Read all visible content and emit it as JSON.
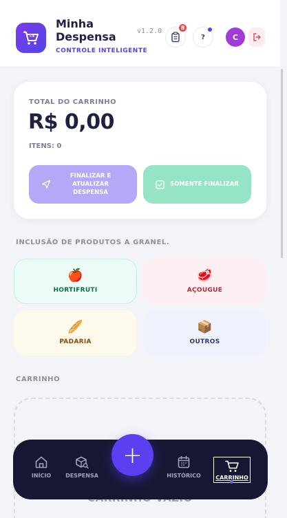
{
  "header": {
    "title": "Minha Despensa",
    "subtitle": "CONTROLE INTELIGENTE",
    "version": "v1.2.0",
    "list_badge": "8",
    "help_label": "?",
    "avatar_initial": "C"
  },
  "summary": {
    "label": "TOTAL DO CARRINHO",
    "total": "R$ 0,00",
    "items": "ITENS: 0",
    "finalize_update_label": "FINALIZAR E ATUALIZAR DESPENSA",
    "finalize_only_label": "SOMENTE FINALIZAR"
  },
  "bulk": {
    "title": "INCLUSÃO DE PRODUTOS A GRANEL.",
    "categories": [
      {
        "label": "HORTIFRUTI",
        "icon": "🍎"
      },
      {
        "label": "AÇOUGUE",
        "icon": "🥩"
      },
      {
        "label": "PADARIA",
        "icon": "🥖"
      },
      {
        "label": "OUTROS",
        "icon": "📦"
      }
    ]
  },
  "cart": {
    "title": "CARRINHO",
    "empty_label": "CARRINHO VAZIO"
  },
  "nav": {
    "items": [
      {
        "label": "INÍCIO",
        "icon": "home-icon"
      },
      {
        "label": "DESPENSA",
        "icon": "box-search-icon"
      },
      {
        "label": "HISTÓRICO",
        "icon": "calendar-icon"
      },
      {
        "label": "CARRINHO",
        "icon": "cart-icon"
      }
    ],
    "fab_label": "+"
  },
  "colors": {
    "accent": "#5b3ff0",
    "nav_bg": "#161833",
    "finalize_update": "#b4a9f6",
    "finalize_only": "#96e4c6",
    "danger": "#ef4444"
  }
}
